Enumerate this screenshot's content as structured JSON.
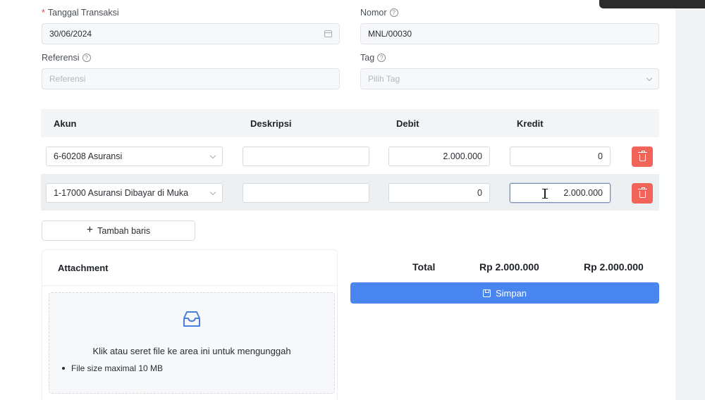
{
  "form": {
    "tanggal": {
      "label": "Tanggal Transaksi",
      "required_mark": "*",
      "value": "30/06/2024"
    },
    "nomor": {
      "label": "Nomor",
      "value": "MNL/00030"
    },
    "referensi": {
      "label": "Referensi",
      "placeholder": "Referensi"
    },
    "tag": {
      "label": "Tag",
      "placeholder": "Pilih Tag"
    }
  },
  "table": {
    "headers": [
      "Akun",
      "Deskripsi",
      "Debit",
      "Kredit"
    ],
    "rows": [
      {
        "akun": "6-60208 Asuransi",
        "deskripsi": "",
        "debit": "2.000.000",
        "kredit": "0"
      },
      {
        "akun": "1-17000 Asuransi Dibayar di Muka",
        "deskripsi": "",
        "debit": "0",
        "kredit": "2.000.000"
      }
    ],
    "add_row_label": "Tambah baris"
  },
  "attachment": {
    "title": "Attachment",
    "dropzone_text": "Klik atau seret file ke area ini untuk mengunggah",
    "hint": "File size maximal 10 MB"
  },
  "totals": {
    "label": "Total",
    "debit": "Rp 2.000.000",
    "kredit": "Rp 2.000.000"
  },
  "save_label": "Simpan",
  "colors": {
    "primary": "#4a86f0",
    "danger": "#f0645a",
    "header_bg": "#f3f5f7"
  },
  "icons": [
    "calendar-icon",
    "help-icon",
    "chevron-down-icon",
    "trash-icon",
    "plus-icon",
    "inbox-icon",
    "save-icon",
    "text-cursor-icon"
  ]
}
